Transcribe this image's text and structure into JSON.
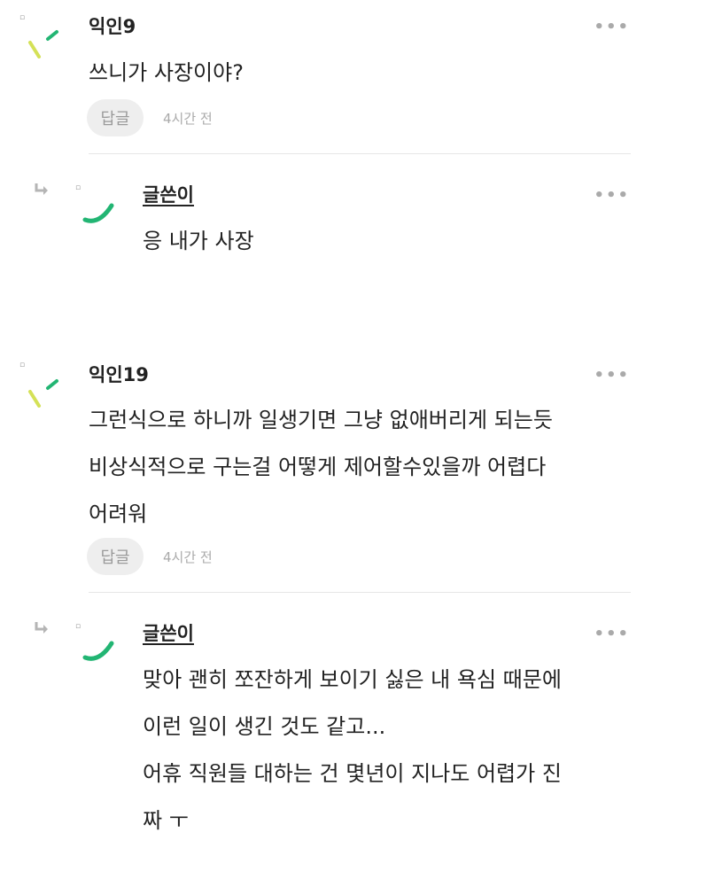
{
  "comments": [
    {
      "author": "익인9",
      "lines": [
        "쓰니가 사장이야?"
      ],
      "reply_label": "답글",
      "time": "4시간 전",
      "more": "•••"
    },
    {
      "author": "글쓴이",
      "lines": [
        "응 내가 사장"
      ],
      "more": "•••",
      "is_reply": true
    },
    {
      "author": "익인19",
      "lines": [
        "그런식으로 하니까 일생기면 그냥 없애버리게 되는듯",
        "비상식적으로 구는걸 어떻게 제어할수있을까 어렵다",
        "어려워"
      ],
      "reply_label": "답글",
      "time": "4시간 전",
      "more": "•••"
    },
    {
      "author": "글쓴이",
      "lines": [
        "맞아 괜히 쪼잔하게 보이기 싫은 내 욕심 때문에",
        "이런 일이 생긴 것도 같고...",
        "어휴 직원들 대하는 건 몇년이 지나도 어렵가 진",
        "짜 ㅜ"
      ],
      "more": "•••",
      "is_reply": true
    }
  ],
  "colors": {
    "avatar_green": "#22b573",
    "avatar_lime": "#8cc63f",
    "avatar_yellow": "#d4e157",
    "muted": "#aaaaaa"
  },
  "icons": {
    "dot": "▫",
    "reply_arrow": "reply-arrow-icon"
  }
}
